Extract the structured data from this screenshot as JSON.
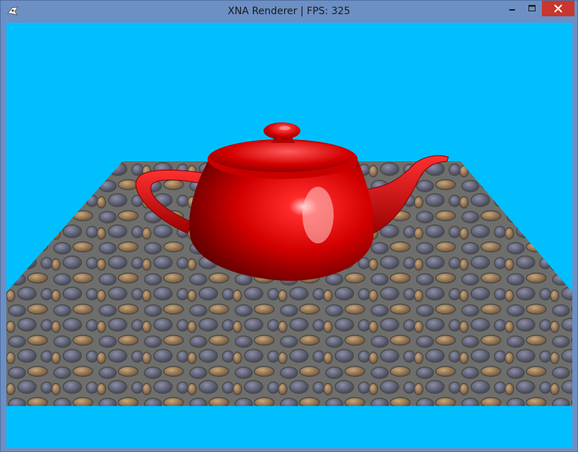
{
  "window": {
    "title": "XNA Renderer | FPS: 325"
  },
  "icons": {
    "app": "xna-app-icon",
    "minimize": "minimize-icon",
    "maximize": "maximize-icon",
    "close": "close-icon"
  },
  "colors": {
    "frame": "#6c8fc4",
    "sky": "#00bfff",
    "close": "#c8362d",
    "teapot": "#e10000",
    "floor": "#6b6b6b"
  },
  "scene": {
    "objects": [
      "teapot",
      "cobblestone-floor"
    ]
  }
}
